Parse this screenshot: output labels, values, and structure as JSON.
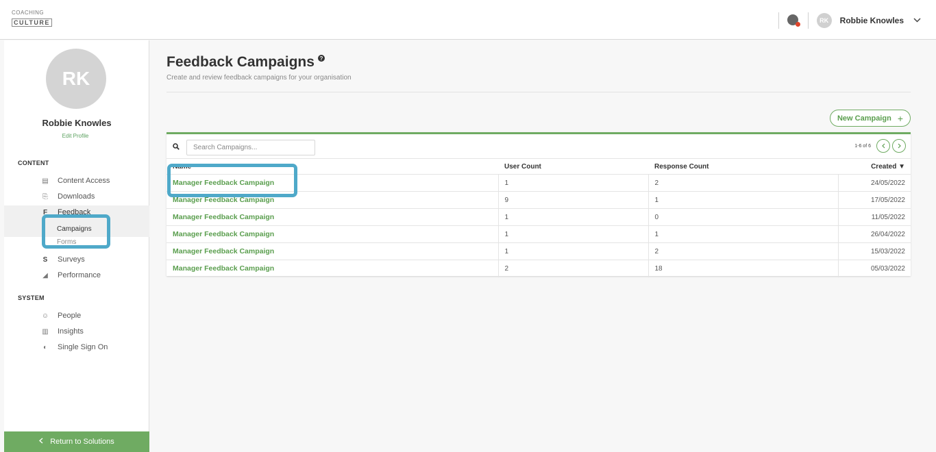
{
  "app": {
    "logo_line1": "COACHING",
    "logo_line2": "CULTURE"
  },
  "topbar": {
    "user_initials": "RK",
    "user_name": "Robbie Knowles",
    "notification_icon": "bell-icon",
    "dropdown_icon": "chevron-down-icon"
  },
  "sidebar": {
    "avatar_initials": "RK",
    "profile_name": "Robbie Knowles",
    "edit_profile": "Edit Profile",
    "content_label": "CONTENT",
    "system_label": "SYSTEM",
    "content_items": [
      {
        "label": "Content Access",
        "icon": "document-icon"
      },
      {
        "label": "Downloads",
        "icon": "download-icon"
      },
      {
        "label": "Feedback",
        "icon": "feedback-icon"
      }
    ],
    "feedback_sub": [
      {
        "label": "Campaigns"
      },
      {
        "label": "Forms"
      }
    ],
    "content_items_2": [
      {
        "label": "Surveys",
        "icon": "survey-icon"
      },
      {
        "label": "Performance",
        "icon": "performance-icon"
      }
    ],
    "system_items": [
      {
        "label": "People",
        "icon": "people-icon"
      },
      {
        "label": "Insights",
        "icon": "chart-icon"
      },
      {
        "label": "Single Sign On",
        "icon": "shield-icon"
      }
    ],
    "return_label": "Return to Solutions"
  },
  "main": {
    "title": "Feedback Campaigns",
    "subtitle": "Create and review feedback campaigns for your organisation",
    "new_campaign": "New Campaign",
    "search_placeholder": "Search Campaigns...",
    "pager_text": "1-6 of 6",
    "columns": [
      "Name",
      "User Count",
      "Response Count",
      "Created ▼"
    ],
    "rows": [
      {
        "name": "Manager Feedback Campaign",
        "user_count": "1",
        "response_count": "2",
        "created": "24/05/2022"
      },
      {
        "name": "Manager Feedback Campaign",
        "user_count": "9",
        "response_count": "1",
        "created": "17/05/2022"
      },
      {
        "name": "Manager Feedback Campaign",
        "user_count": "1",
        "response_count": "0",
        "created": "11/05/2022"
      },
      {
        "name": "Manager Feedback Campaign",
        "user_count": "1",
        "response_count": "1",
        "created": "26/04/2022"
      },
      {
        "name": "Manager Feedback Campaign",
        "user_count": "1",
        "response_count": "2",
        "created": "15/03/2022"
      },
      {
        "name": "Manager Feedback Campaign",
        "user_count": "2",
        "response_count": "18",
        "created": "05/03/2022"
      }
    ]
  },
  "colors": {
    "accent": "#6fab62",
    "highlight": "#4fa9c9"
  }
}
